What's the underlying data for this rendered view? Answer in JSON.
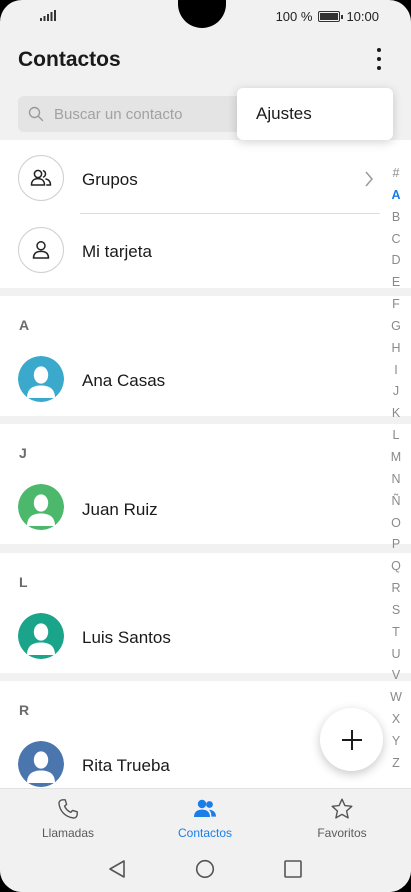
{
  "status_bar": {
    "battery_text": "100 %",
    "time": "10:00",
    "battery_level": 1.0
  },
  "app_bar": {
    "title": "Contactos",
    "more_icon": "more-vertical-icon"
  },
  "search": {
    "placeholder": "Buscar un contacto"
  },
  "overflow_menu": {
    "items": [
      {
        "label": "Ajustes"
      }
    ]
  },
  "top_items": [
    {
      "label": "Grupos",
      "icon": "group-icon"
    },
    {
      "label": "Mi tarjeta",
      "icon": "person-icon"
    }
  ],
  "sections": [
    {
      "letter": "A",
      "contact": "Ana Casas",
      "color": "#3aa9cc"
    },
    {
      "letter": "J",
      "contact": "Juan Ruiz",
      "color": "#4cb86c"
    },
    {
      "letter": "L",
      "contact": "Luis Santos",
      "color": "#1aa58a"
    },
    {
      "letter": "R",
      "contact": "Rita Trueba",
      "color": "#4a76ad"
    }
  ],
  "alpha_index": {
    "letters": [
      "#",
      "A",
      "B",
      "C",
      "D",
      "E",
      "F",
      "G",
      "H",
      "I",
      "J",
      "K",
      "L",
      "M",
      "N",
      "Ñ",
      "O",
      "P",
      "Q",
      "R",
      "S",
      "T",
      "U",
      "V",
      "W",
      "X",
      "Y",
      "Z"
    ],
    "active": "A",
    "active_color": "#1b7ee8"
  },
  "bottom_nav": [
    {
      "label": "Llamadas",
      "icon": "phone-icon"
    },
    {
      "label": "Contactos",
      "icon": "contacts-icon",
      "active": true
    },
    {
      "label": "Favoritos",
      "icon": "star-icon"
    }
  ],
  "fab": {
    "icon": "plus-icon"
  },
  "system_nav": [
    "back-icon",
    "home-icon",
    "recents-icon"
  ]
}
